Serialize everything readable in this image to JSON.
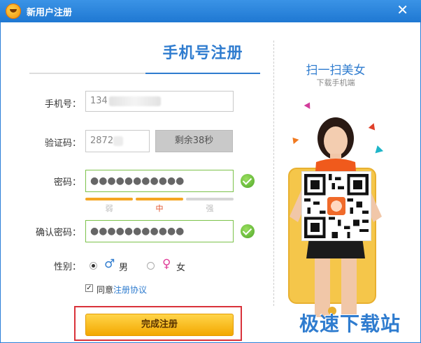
{
  "window": {
    "title": "新用户注册",
    "close_glyph": "✕"
  },
  "form": {
    "heading": "手机号注册",
    "phone": {
      "label": "手机号：",
      "value": "134"
    },
    "code": {
      "label": "验证码：",
      "value": "2872",
      "timer": "剩余38秒"
    },
    "password": {
      "label": "密码：",
      "masked": "●●●●●●●●●●●"
    },
    "strength": {
      "weak": "弱",
      "medium": "中",
      "strong": "强"
    },
    "confirm": {
      "label": "确认密码：",
      "masked": "●●●●●●●●●●●"
    },
    "gender": {
      "label": "性别：",
      "male_icon": "♂",
      "male": "男",
      "female_icon": "♀",
      "female": "女"
    },
    "agree": {
      "prefix": "同意",
      "link": "注册协议",
      "checkmark": "✓"
    },
    "submit": "完成注册"
  },
  "promo": {
    "title": "扫一扫美女",
    "subtitle": "下载手机端"
  },
  "watermark": "极速下载站",
  "colors": {
    "accent": "#2f7ccf",
    "titlebar": "#1f78d2",
    "button": "#f3a800",
    "ok": "#4fa62a",
    "highlight": "#d9323a"
  }
}
